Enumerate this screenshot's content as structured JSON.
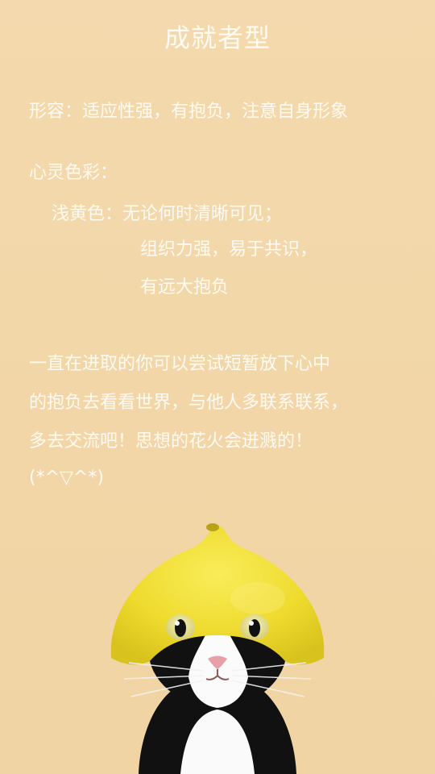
{
  "page": {
    "title": "成就者型",
    "description": {
      "label": "形容：",
      "text": "适应性强，有抱负，注意自身形象"
    },
    "heart_color": {
      "label": "心灵色彩：",
      "color_name": "浅黄色：",
      "lines": [
        "无论何时清晰可见；",
        "组织力强，易于共识，",
        "有远大抱负"
      ]
    },
    "message_lines": [
      "一直在进取的你可以尝试短暂放下心中",
      "的抱负去看看世界，与他人多联系联系，",
      "多去交流吧！思想的花火会迸溅的！",
      "(*^▽^*)"
    ]
  },
  "colors": {
    "background": "#f2d6a8",
    "text": "#fffaf2",
    "lemon": "#f1df32"
  }
}
